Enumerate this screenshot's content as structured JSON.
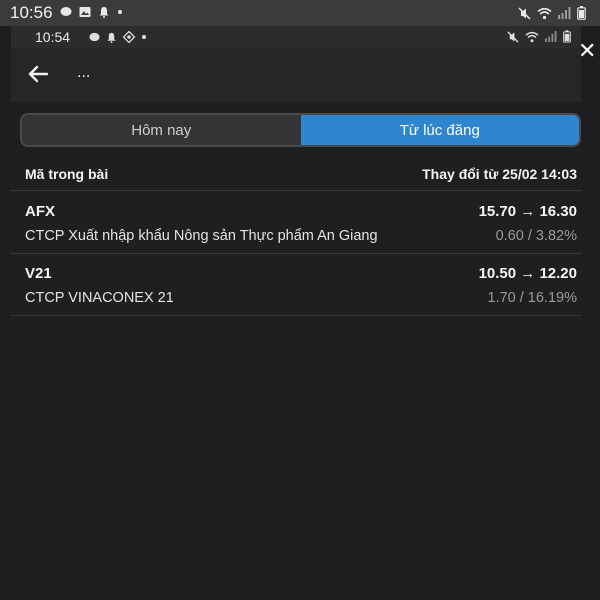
{
  "outer_status": {
    "time": "10:56"
  },
  "inner_status": {
    "time": "10:54"
  },
  "header": {
    "more_label": "..."
  },
  "tabs": [
    {
      "label": "Hôm nay",
      "active": false
    },
    {
      "label": "Từ lúc đăng",
      "active": true
    }
  ],
  "list_header": {
    "left": "Mã trong bài",
    "right": "Thay đổi từ 25/02 14:03"
  },
  "stocks": [
    {
      "code": "AFX",
      "name": "CTCP Xuất nhập khẩu Nông sản Thực phẩm An Giang",
      "price": "15.70 → 16.30",
      "change": "0.60 / 3.82%"
    },
    {
      "code": "V21",
      "name": "CTCP VINACONEX 21",
      "price": "10.50 → 12.20",
      "change": "1.70 / 16.19%"
    }
  ],
  "colors": {
    "accent": "#2f86cf",
    "background": "#1f1f21",
    "muted": "#9a9a9c"
  }
}
